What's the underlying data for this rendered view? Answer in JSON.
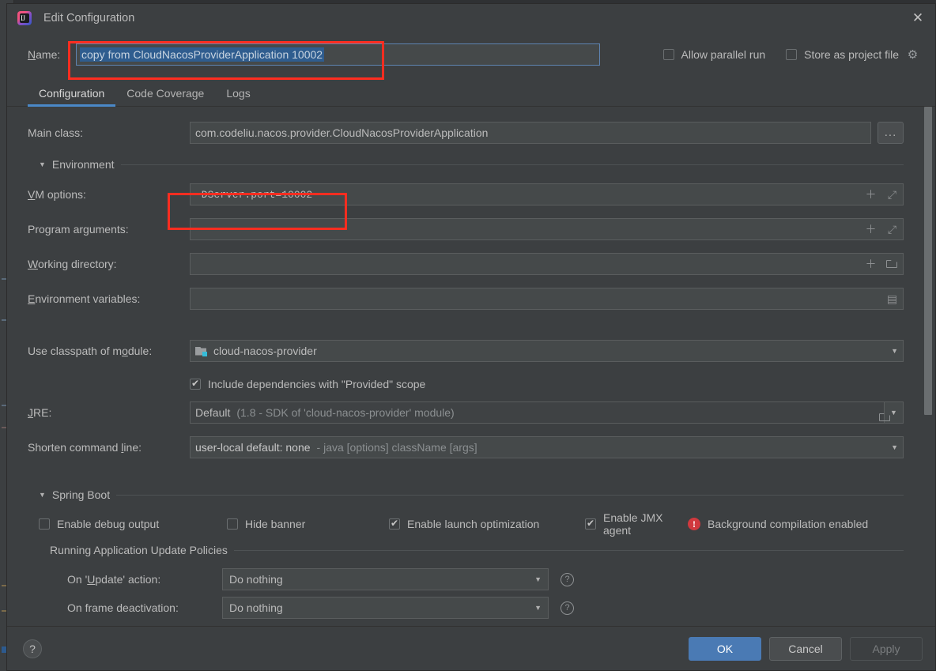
{
  "window": {
    "title": "Edit Configuration",
    "logo_icon": "intellij-idea-logo",
    "close_icon": "close-icon"
  },
  "name_row": {
    "label": "Name:",
    "label_mnemonic": "N",
    "value": "copy from CloudNacosProviderApplication 10002",
    "allow_parallel_run": {
      "label": "Allow parallel run",
      "checked": false
    },
    "store_as_project_file": {
      "label": "Store as project file",
      "checked": false
    },
    "gear_icon": "gear-icon"
  },
  "tabs": [
    {
      "label": "Configuration",
      "active": true
    },
    {
      "label": "Code Coverage",
      "active": false
    },
    {
      "label": "Logs",
      "active": false
    }
  ],
  "form": {
    "main_class": {
      "label": "Main class:",
      "value": "com.codeliu.nacos.provider.CloudNacosProviderApplication",
      "browse_label": "..."
    },
    "environment_section": "Environment",
    "vm_options": {
      "label": "VM options:",
      "value": "-DServer.port=10002",
      "mnemonic": "V"
    },
    "program_arguments": {
      "label": "Program arguments:",
      "value": "",
      "mnemonic": "g"
    },
    "working_directory": {
      "label": "Working directory:",
      "value": "",
      "mnemonic": "W"
    },
    "environment_variables": {
      "label": "Environment variables:",
      "value": "",
      "mnemonic": "E"
    },
    "use_classpath": {
      "label": "Use classpath of module:",
      "value": "cloud-nacos-provider",
      "module_icon": "module-folder-icon"
    },
    "include_provided": {
      "label": "Include dependencies with \"Provided\" scope",
      "checked": true
    },
    "jre": {
      "label": "JRE:",
      "value": "Default",
      "hint": "(1.8 - SDK of 'cloud-nacos-provider' module)",
      "folder_icon": "folder-icon"
    },
    "shorten_command_line": {
      "label": "Shorten command line:",
      "value": "user-local default: none",
      "hint": "- java [options] className [args]"
    }
  },
  "spring_boot": {
    "section": "Spring Boot",
    "enable_debug_output": {
      "label": "Enable debug output",
      "checked": false
    },
    "hide_banner": {
      "label": "Hide banner",
      "checked": false
    },
    "enable_launch_optimization": {
      "label": "Enable launch optimization",
      "checked": true
    },
    "enable_jmx_agent": {
      "label": "Enable JMX agent",
      "checked": true
    },
    "background_compilation": {
      "label": "Background compilation enabled",
      "icon": "error-icon"
    },
    "policies_section": "Running Application Update Policies",
    "on_update_action": {
      "label": "On 'Update' action:",
      "value": "Do nothing",
      "help_icon": "help-icon"
    },
    "on_frame_deactivation": {
      "label": "On frame deactivation:",
      "value": "Do nothing",
      "help_icon": "help-icon"
    }
  },
  "footer": {
    "help_icon": "?",
    "ok": "OK",
    "cancel": "Cancel",
    "apply": "Apply"
  },
  "colors": {
    "accent": "#4a88c7",
    "selection": "#2f5d8f",
    "highlight_box": "#ff2d20",
    "error": "#d0393e",
    "module_badge": "#35bcd8"
  }
}
